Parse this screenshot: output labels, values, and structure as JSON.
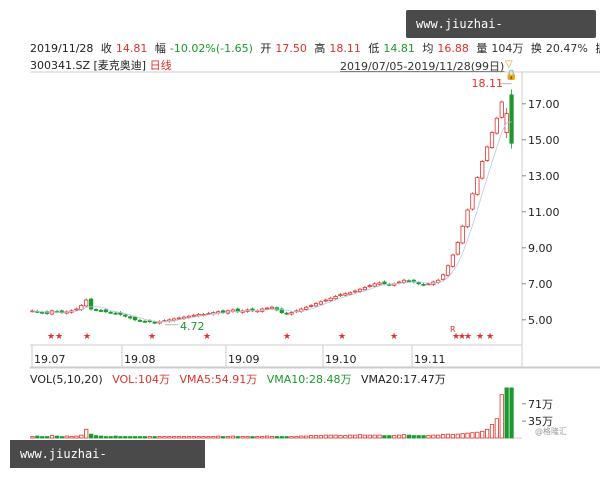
{
  "watermark": "www.jiuzhai-hotspring.com",
  "info": {
    "date": "2019/11/28",
    "close_label": "收",
    "close": "14.81",
    "change_label": "幅",
    "change": "-10.02%(-1.65)",
    "open_label": "开",
    "open": "17.50",
    "high_label": "高",
    "high": "18.11",
    "low_label": "低",
    "low": "14.81",
    "avg_label": "均",
    "avg": "16.88",
    "volume_label": "量",
    "volume": "104万",
    "turnover_label": "换",
    "turnover": "20.47%",
    "amplitude_label": "振"
  },
  "stock": {
    "code_name": "300341.SZ [麦克奥迪]",
    "period": "日线",
    "range": "2019/07/05-2019/11/28(99日)"
  },
  "chart_data": {
    "type": "candlestick",
    "x_ticks": [
      "19.07",
      "19.08",
      "19.09",
      "19.10",
      "19.11"
    ],
    "y_ticks": [
      "17.00",
      "15.00",
      "13.00",
      "11.00",
      "9.00",
      "7.00",
      "5.00"
    ],
    "ylim": [
      3.6,
      18.6
    ],
    "annotations": {
      "high_marker": "18.11",
      "low_marker": "4.72",
      "r_marker": "R"
    },
    "closes": [
      5.5,
      5.45,
      5.4,
      5.35,
      5.5,
      5.45,
      5.4,
      5.45,
      5.5,
      5.6,
      5.8,
      6.1,
      5.6,
      5.55,
      5.5,
      5.45,
      5.4,
      5.35,
      5.3,
      5.2,
      5.1,
      5.0,
      4.95,
      4.9,
      4.9,
      4.85,
      4.9,
      4.95,
      5.0,
      5.05,
      5.1,
      5.15,
      5.2,
      5.25,
      5.3,
      5.3,
      5.35,
      5.4,
      5.45,
      5.4,
      5.5,
      5.55,
      5.45,
      5.5,
      5.55,
      5.5,
      5.5,
      5.6,
      5.65,
      5.7,
      5.55,
      5.4,
      5.35,
      5.4,
      5.5,
      5.6,
      5.7,
      5.8,
      5.9,
      6.0,
      6.1,
      6.2,
      6.3,
      6.4,
      6.45,
      6.5,
      6.6,
      6.7,
      6.8,
      6.9,
      7.0,
      7.05,
      7.0,
      6.95,
      7.0,
      7.1,
      7.2,
      7.15,
      7.1,
      7.0,
      6.95,
      7.0,
      7.1,
      7.2,
      7.5,
      8.0,
      8.6,
      9.3,
      10.2,
      11.1,
      12.0,
      12.9,
      13.8,
      14.6,
      15.4,
      16.2,
      17.1,
      16.46,
      14.81
    ],
    "volume_legend": {
      "vol": "VOL(5,10,20)",
      "vol_value": "VOL:104万",
      "vma5": "VMA5:54.91万",
      "vma10": "VMA10:28.48万",
      "vma20": "VMA20:17.47万"
    },
    "volume_ticks": [
      "71万",
      "35万"
    ],
    "volumes": [
      3,
      4,
      3,
      3,
      5,
      4,
      3,
      4,
      3,
      4,
      6,
      18,
      8,
      5,
      4,
      3,
      3,
      4,
      3,
      3,
      3,
      3,
      3,
      3,
      3,
      3,
      3,
      3,
      3,
      3,
      3,
      3,
      3,
      3,
      3,
      3,
      3,
      3,
      4,
      3,
      3,
      4,
      3,
      3,
      3,
      3,
      3,
      3,
      4,
      3,
      3,
      3,
      3,
      3,
      3,
      4,
      4,
      5,
      5,
      5,
      6,
      6,
      6,
      5,
      5,
      6,
      6,
      7,
      6,
      6,
      6,
      6,
      5,
      5,
      5,
      6,
      7,
      6,
      5,
      5,
      5,
      5,
      6,
      6,
      7,
      8,
      7,
      8,
      9,
      10,
      11,
      12,
      14,
      18,
      28,
      40,
      90,
      104,
      104
    ]
  },
  "star_marks": "★",
  "logo_text": "@格隆汇"
}
